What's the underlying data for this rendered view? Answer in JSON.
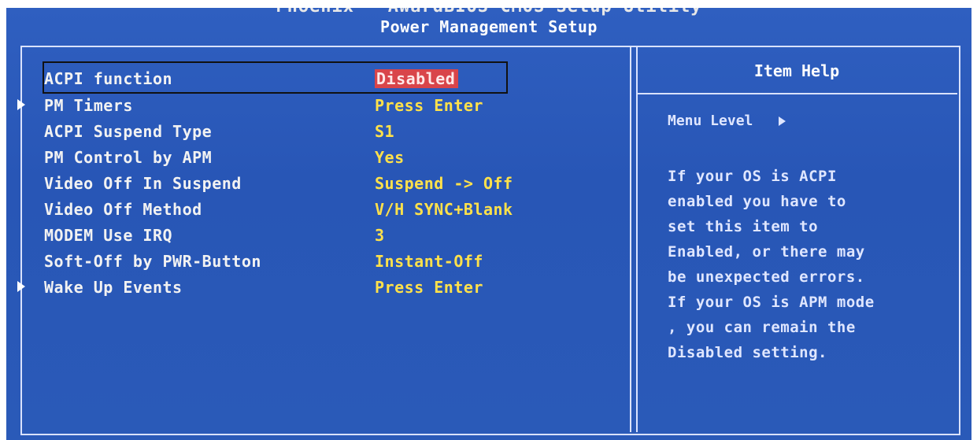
{
  "header": {
    "vendor_line": "Phoenix - AwardBIOS CMOS Setup Utility",
    "page_title": "Power Management Setup"
  },
  "settings": [
    {
      "label": "ACPI function",
      "value": "Disabled",
      "submenu": false,
      "selected": true
    },
    {
      "label": "PM Timers",
      "value": "Press Enter",
      "submenu": true,
      "selected": false
    },
    {
      "label": "ACPI Suspend Type",
      "value": "S1",
      "submenu": false,
      "selected": false
    },
    {
      "label": "PM Control by APM",
      "value": "Yes",
      "submenu": false,
      "selected": false
    },
    {
      "label": "Video Off In Suspend",
      "value": "Suspend -> Off",
      "submenu": false,
      "selected": false
    },
    {
      "label": "Video Off Method",
      "value": "V/H SYNC+Blank",
      "submenu": false,
      "selected": false
    },
    {
      "label": "MODEM Use IRQ",
      "value": "3",
      "submenu": false,
      "selected": false
    },
    {
      "label": "Soft-Off by PWR-Button",
      "value": "Instant-Off",
      "submenu": false,
      "selected": false
    },
    {
      "label": "Wake Up Events",
      "value": "Press Enter",
      "submenu": true,
      "selected": false
    }
  ],
  "help": {
    "title": "Item Help",
    "menu_level_label": "Menu Level",
    "lines": [
      "If your OS is ACPI",
      "enabled you have to",
      "set this item to",
      "Enabled, or there may",
      "be unexpected errors.",
      "If your OS is APM mode",
      ", you can remain the",
      "Disabled setting."
    ]
  },
  "colors": {
    "background": "#2a5ab8",
    "label": "#f2f2f2",
    "value": "#ffe14a",
    "selection": "#d9454a"
  }
}
